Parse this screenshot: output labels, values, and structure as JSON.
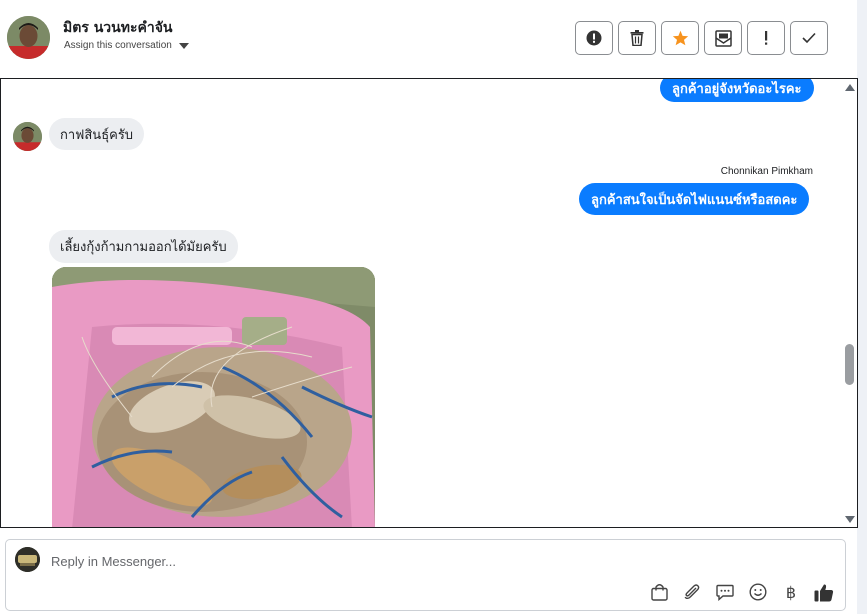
{
  "header": {
    "contact_name": "มิตร นวนทะคำจัน",
    "assign_label": "Assign this conversation",
    "actions": [
      {
        "name": "spam-button",
        "icon": "alert-circle-icon"
      },
      {
        "name": "delete-button",
        "icon": "trash-icon"
      },
      {
        "name": "star-button",
        "icon": "star-icon",
        "color": "#f7931e"
      },
      {
        "name": "mark-unread-button",
        "icon": "mail-icon"
      },
      {
        "name": "follow-up-button",
        "icon": "exclamation-icon"
      },
      {
        "name": "done-button",
        "icon": "check-icon"
      }
    ]
  },
  "conversation": {
    "messages": [
      {
        "direction": "out",
        "text": "ลูกค้าอยู่จังหวัดอะไรคะ"
      },
      {
        "direction": "in",
        "text": "กาฟสินธุ์ครับ"
      },
      {
        "direction": "out",
        "sender": "Chonnikan Pimkham",
        "text": "ลูกค้าสนใจเป็นจัดไฟแนนซ์หรือสดคะ"
      },
      {
        "direction": "in",
        "text": "เลี้ยงกุ้งก้ามกามออกได้มัยครับ"
      },
      {
        "direction": "in",
        "type": "image",
        "image": "photo of freshwater prawns in a pink plastic basket on grass"
      }
    ]
  },
  "composer": {
    "placeholder": "Reply in Messenger...",
    "tools": [
      "shopping-bag-icon",
      "paperclip-icon",
      "saved-reply-icon",
      "emoji-icon",
      "baht-icon",
      "thumbs-up-icon"
    ],
    "baht_symbol": "฿"
  },
  "colors": {
    "outgoing_bubble": "#0a7cff",
    "incoming_bubble": "#eceef1",
    "accent_star": "#f7931e"
  }
}
